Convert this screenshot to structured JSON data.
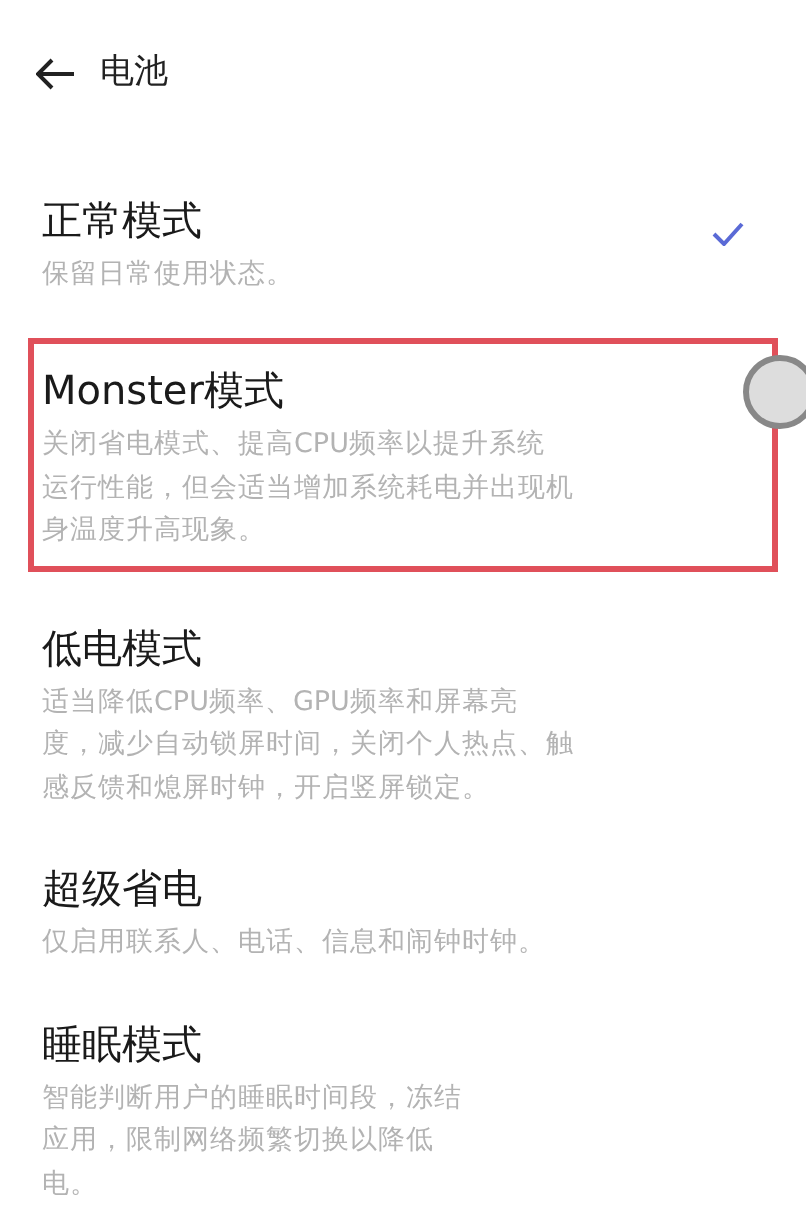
{
  "header": {
    "title": "电池"
  },
  "modes": [
    {
      "title": "正常模式",
      "description": [
        "保留日常使用状态。"
      ],
      "selected": true,
      "highlighted": false
    },
    {
      "title": "Monster模式",
      "description": [
        "关闭省电模式、提高CPU频率以提升系统",
        "运行性能，但会适当增加系统耗电并出现机",
        "身温度升高现象。"
      ],
      "selected": false,
      "highlighted": true
    },
    {
      "title": "低电模式",
      "description": [
        "适当降低CPU频率、GPU频率和屏幕亮",
        "度，减少自动锁屏时间，关闭个人热点、触",
        "感反馈和熄屏时钟，开启竖屏锁定。"
      ],
      "selected": false,
      "highlighted": false
    },
    {
      "title": "超级省电",
      "description": [
        "仅启用联系人、电话、信息和闹钟时钟。"
      ],
      "selected": false,
      "highlighted": false
    },
    {
      "title": "睡眠模式",
      "description": [
        "智能判断用户的睡眠时间段，冻结",
        "应用，限制网络频繁切换以降低",
        "电。"
      ],
      "selected": false,
      "highlighted": false
    }
  ]
}
